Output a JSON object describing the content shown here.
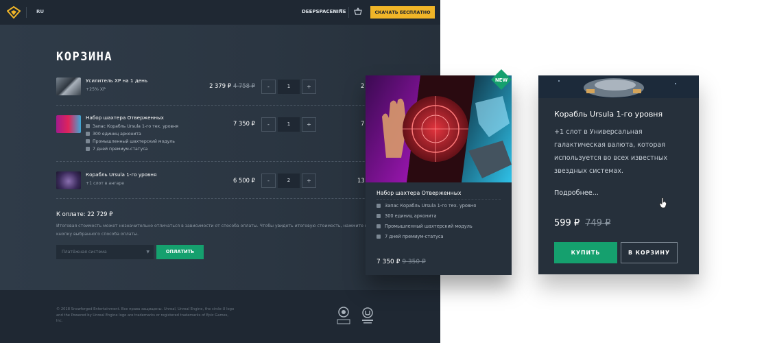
{
  "topbar": {
    "lang": "RU",
    "username": "DEEPSPACENINE",
    "download_label": "СКАЧАТЬ БЕСПЛАТНО"
  },
  "page_title": "КОРЗИНА",
  "cart": {
    "items": [
      {
        "name": "Усилитель XP на 1 день",
        "sub": "+25% XP",
        "price": "2 379 ₽",
        "old_price": "4 758 ₽",
        "qty": "1",
        "total_cut": "2"
      },
      {
        "name": "Набор шахтера Отверженных",
        "features": [
          "Запас Корабль Ursula 1-го тех. уровня",
          "300 единиц арконита",
          "Промышленный шахтерский модуль",
          "7 дней премиум-статуса"
        ],
        "price": "7 350 ₽",
        "qty": "1",
        "total_cut": "7"
      },
      {
        "name": "Корабль Ursula 1-го уровня",
        "sub": "+1 слот в ангаре",
        "price": "6 500 ₽",
        "qty": "2",
        "total_cut": "13"
      }
    ],
    "minus": "-",
    "plus": "+"
  },
  "payment": {
    "total": "К оплате: 22 729 ₽",
    "note": "Итоговая стоимость может незначительно отличаться в зависимости от способа оплаты. Чтобы увидеть итоговую стоимость, нажмите на кнопку выбранного способа оплаты.",
    "select_placeholder": "Платёжная система",
    "pay_label": "ОПЛАТИТЬ"
  },
  "footer": {
    "legal": "© 2018 Snowforged Entertainment. Все права защищены. Unreal, Unreal Engine, the circle-U logo and the Powered by Unreal Engine logo are trademarks or registered trademarks of Epic Games, Inc."
  },
  "product_card": {
    "badge": "NEW",
    "title": "Набор шахтера Отверженных",
    "features": [
      "Запас Корабль Ursula 1-го тех. уровня",
      "300 единиц арконита",
      "Промышленный шахтерский модуль",
      "7 дней премиум-статуса"
    ],
    "price": "7 350 ₽",
    "old_price": "9 350 ₽"
  },
  "tooltip_card": {
    "title": "Корабль Ursula 1-го уровня",
    "description": "+1 слот в Универсальная галактическая валюта, которая используется во всех известных звездных системах.",
    "more": "Подробнее...",
    "price": "599 ₽",
    "old_price": "749 ₽",
    "buy_label": "КУПИТЬ",
    "cart_label": "В КОРЗИНУ"
  },
  "colors": {
    "accent_yellow": "#f0b528",
    "accent_green": "#15a06e",
    "bg_dark": "#1f2833",
    "bg_panel": "#2b3642"
  }
}
